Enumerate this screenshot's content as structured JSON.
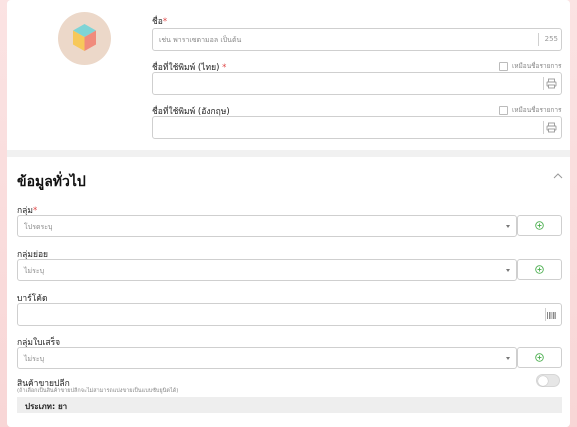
{
  "colors": {
    "accent": "#4caf50",
    "required": "#e04848"
  },
  "name_field": {
    "label": "ชื่อ",
    "required_mark": "*",
    "placeholder": "เช่น พาราเซตามอล เป็นต้น",
    "max_length": "255"
  },
  "print_name_th": {
    "label": "ชื่อที่ใช้พิมพ์ (ไทย)",
    "required_mark": "*",
    "same_as_label": "เหมือนชื่อรายการ",
    "icon": "printer-icon"
  },
  "print_name_en": {
    "label": "ชื่อที่ใช้พิมพ์ (อังกฤษ)",
    "same_as_label": "เหมือนชื่อรายการ",
    "icon": "printer-icon"
  },
  "general": {
    "title": "ข้อมูลทั่วไป",
    "group": {
      "label": "กลุ่ม",
      "required_mark": "*",
      "placeholder": "โปรดระบุ"
    },
    "subgroup": {
      "label": "กลุ่มย่อย",
      "placeholder": "ไม่ระบุ"
    },
    "barcode": {
      "label": "บาร์โค้ด",
      "value": "",
      "icon": "barcode-icon"
    },
    "receipt_group": {
      "label": "กลุ่มใบเสร็จ",
      "placeholder": "ไม่ระบุ"
    },
    "retail": {
      "label": "สินค้าขายปลีก",
      "note": "(ถ้าเลือกเป็นสินค้าขายปลีกจะไม่สามารถแบ่งขายเป็นแบบซับยูนิตได้)",
      "enabled": false
    },
    "type_bar": {
      "label": "ประเภท: ยา"
    }
  }
}
